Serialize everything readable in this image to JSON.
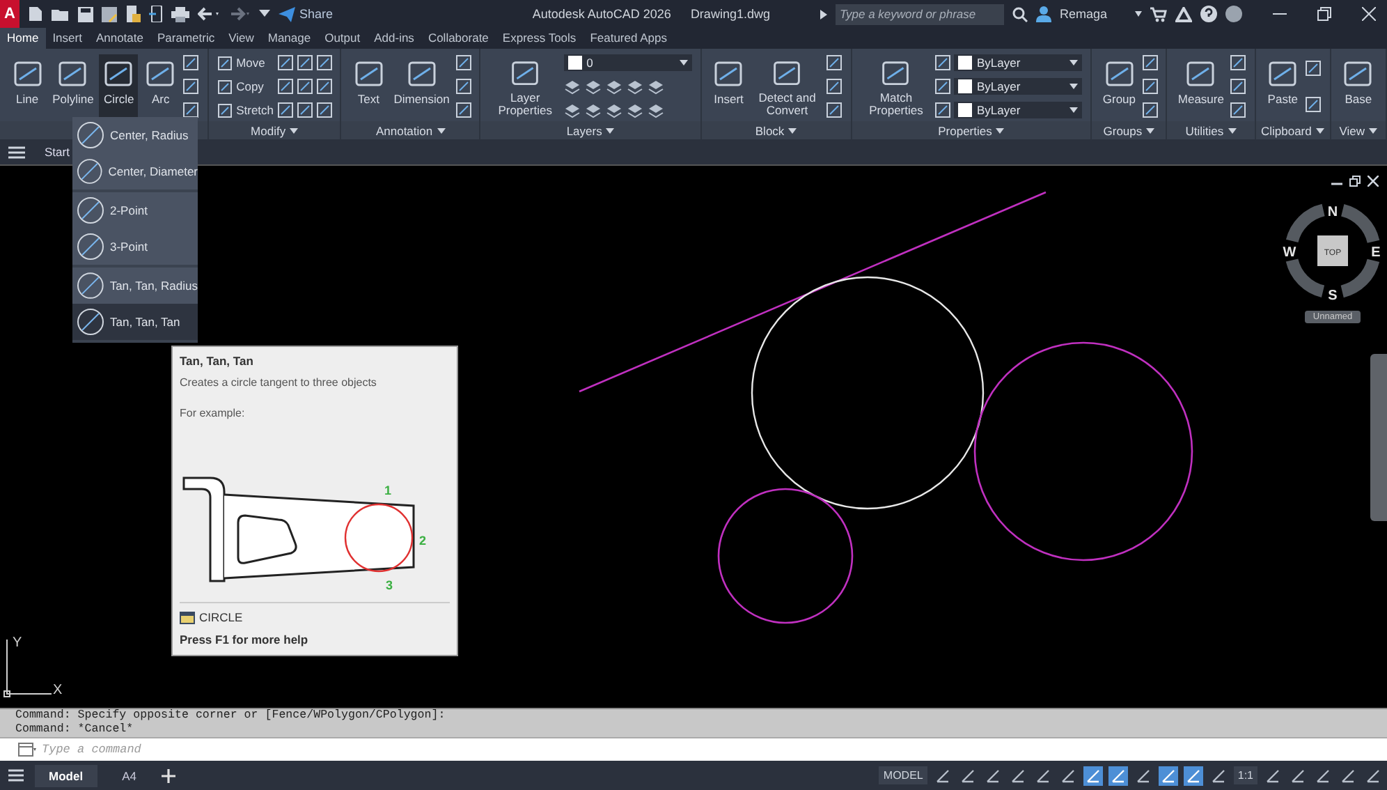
{
  "title_bar": {
    "app_logo": "A",
    "share": "Share",
    "title": "Autodesk AutoCAD 2026",
    "file": "Drawing1.dwg",
    "search": {
      "placeholder": "Type a keyword or phrase"
    },
    "user": "Remaga"
  },
  "tabs": [
    {
      "label": "Home",
      "selected": true
    },
    {
      "label": "Insert",
      "selected": false
    },
    {
      "label": "Annotate",
      "selected": false
    },
    {
      "label": "Parametric",
      "selected": false
    },
    {
      "label": "View",
      "selected": false
    },
    {
      "label": "Manage",
      "selected": false
    },
    {
      "label": "Output",
      "selected": false
    },
    {
      "label": "Add-ins",
      "selected": false
    },
    {
      "label": "Collaborate",
      "selected": false
    },
    {
      "label": "Express Tools",
      "selected": false
    },
    {
      "label": "Featured Apps",
      "selected": false
    }
  ],
  "ribbon": [
    {
      "columns": [
        [
          {
            "kind": "large",
            "label": "Line",
            "pressed": false
          }
        ],
        [
          {
            "kind": "large",
            "label": "Polyline",
            "pressed": false
          }
        ],
        [
          {
            "kind": "large",
            "label": "Circle",
            "pressed": true
          }
        ],
        [
          {
            "kind": "large",
            "label": "Arc",
            "pressed": false
          }
        ],
        [
          {
            "kind": "icon"
          },
          {
            "kind": "icon"
          },
          {
            "kind": "icon"
          }
        ]
      ]
    },
    {
      "title": "Modify",
      "columns": [
        [
          {
            "kind": "small",
            "label": "Move"
          },
          {
            "kind": "small",
            "label": "Copy"
          },
          {
            "kind": "small",
            "label": "Stretch"
          }
        ],
        [
          {
            "kind": "icon"
          },
          {
            "kind": "icon"
          },
          {
            "kind": "icon"
          }
        ],
        [
          {
            "kind": "icon"
          },
          {
            "kind": "icon"
          },
          {
            "kind": "icon"
          }
        ],
        [
          {
            "kind": "icon"
          },
          {
            "kind": "icon"
          },
          {
            "kind": "icon"
          }
        ]
      ]
    },
    {
      "title": "Annotation",
      "columns": [
        [
          {
            "kind": "large",
            "label": "Text",
            "pressed": false
          }
        ],
        [
          {
            "kind": "large",
            "label": "Dimension",
            "pressed": false
          }
        ],
        [
          {
            "kind": "icon"
          },
          {
            "kind": "icon"
          },
          {
            "kind": "icon"
          }
        ]
      ]
    },
    {
      "title": "Layers",
      "columns": [
        [
          {
            "kind": "large",
            "label": "Layer Properties",
            "pressed": false
          }
        ],
        [
          {
            "kind": "combo",
            "label": "0"
          },
          {
            "kind": "icon_row"
          },
          {
            "kind": "icon_row"
          }
        ]
      ]
    },
    {
      "title": "Block",
      "columns": [
        [
          {
            "kind": "large",
            "label": "Insert",
            "pressed": false
          }
        ],
        [
          {
            "kind": "large",
            "label": "Detect and Convert",
            "pressed": false
          }
        ],
        [
          {
            "kind": "icon"
          },
          {
            "kind": "icon"
          },
          {
            "kind": "icon"
          }
        ]
      ]
    },
    {
      "title": "Properties",
      "columns": [
        [
          {
            "kind": "large",
            "label": "Match Properties",
            "pressed": false
          }
        ],
        [
          {
            "kind": "icon"
          },
          {
            "kind": "icon"
          },
          {
            "kind": "icon"
          }
        ],
        [
          {
            "kind": "combo",
            "label": "ByLayer"
          },
          {
            "kind": "combo",
            "label": "ByLayer"
          },
          {
            "kind": "combo",
            "label": "ByLayer"
          }
        ]
      ]
    },
    {
      "title": "Groups",
      "columns": [
        [
          {
            "kind": "large",
            "label": "Group",
            "pressed": false
          }
        ],
        [
          {
            "kind": "icon"
          },
          {
            "kind": "icon"
          },
          {
            "kind": "icon"
          }
        ]
      ]
    },
    {
      "title": "Utilities",
      "columns": [
        [
          {
            "kind": "large",
            "label": "Measure",
            "pressed": false
          }
        ],
        [
          {
            "kind": "icon"
          },
          {
            "kind": "icon"
          },
          {
            "kind": "icon"
          }
        ]
      ]
    },
    {
      "title": "Clipboard",
      "columns": [
        [
          {
            "kind": "large",
            "label": "Paste",
            "pressed": false
          }
        ],
        [
          {
            "kind": "icon"
          },
          {
            "kind": "icon"
          }
        ]
      ]
    },
    {
      "title": "View",
      "columns": [
        [
          {
            "kind": "large",
            "label": "Base",
            "pressed": false
          }
        ]
      ]
    }
  ],
  "start_tab": "Start",
  "circle_menu": [
    [
      {
        "label": "Center, Radius",
        "selected": false
      },
      {
        "label": "Center, Diameter",
        "selected": false
      }
    ],
    [
      {
        "label": "2-Point",
        "selected": false
      },
      {
        "label": "3-Point",
        "selected": false
      }
    ],
    [
      {
        "label": "Tan, Tan, Radius",
        "selected": false
      },
      {
        "label": "Tan, Tan, Tan",
        "selected": true
      }
    ]
  ],
  "tooltip": {
    "title": "Tan, Tan, Tan",
    "description": "Creates a circle tangent to three objects",
    "example_heading": "For example:",
    "example_labels": [
      "1",
      "2",
      "3"
    ],
    "command": "CIRCLE",
    "help": "Press F1 for more help"
  },
  "viewcube": {
    "north": "N",
    "south": "S",
    "east": "E",
    "west": "W",
    "face": "TOP",
    "ucs_name": "Unnamed"
  },
  "ucs": {
    "x": "X",
    "y": "Y"
  },
  "command_history": [
    "Command: Specify opposite corner or [Fence/WPolygon/CPolygon]:",
    "Command: *Cancel*"
  ],
  "command_line": {
    "placeholder": "Type a command"
  },
  "layout_tabs": [
    {
      "label": "Model",
      "selected": true
    },
    {
      "label": "A4",
      "selected": false
    }
  ],
  "status_bar": [
    {
      "kind": "text",
      "label": "MODEL"
    },
    {
      "kind": "toggle",
      "on": false
    },
    {
      "kind": "toggle",
      "on": false
    },
    {
      "kind": "toggle",
      "on": false
    },
    {
      "kind": "toggle",
      "on": false
    },
    {
      "kind": "toggle",
      "on": false
    },
    {
      "kind": "toggle",
      "on": false
    },
    {
      "kind": "toggle",
      "on": true
    },
    {
      "kind": "toggle",
      "on": true
    },
    {
      "kind": "toggle",
      "on": false
    },
    {
      "kind": "toggle",
      "on": true
    },
    {
      "kind": "toggle",
      "on": true
    },
    {
      "kind": "toggle",
      "on": false
    },
    {
      "kind": "text",
      "label": "1:1"
    },
    {
      "kind": "toggle",
      "on": false
    },
    {
      "kind": "toggle",
      "on": false
    },
    {
      "kind": "toggle",
      "on": false
    },
    {
      "kind": "toggle",
      "on": false
    },
    {
      "kind": "toggle",
      "on": false
    }
  ]
}
